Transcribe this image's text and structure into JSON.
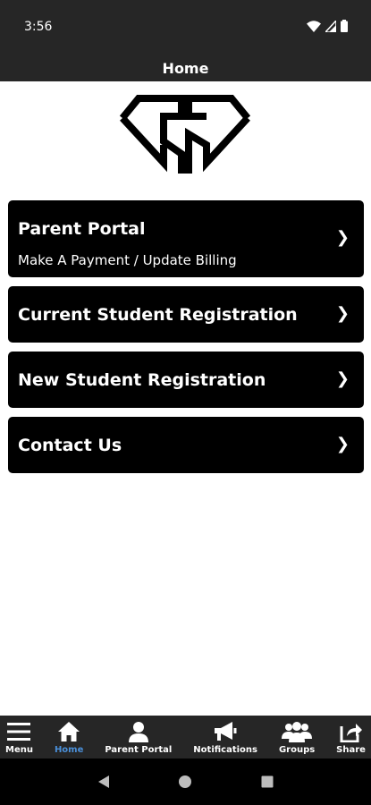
{
  "status_bar": {
    "time": "3:56",
    "icons": [
      "wifi-icon",
      "cell-signal-icon",
      "battery-icon"
    ]
  },
  "header": {
    "title": "Home"
  },
  "logo": {
    "icon": "school-logo-icon"
  },
  "menu": [
    {
      "title": "Parent Portal",
      "subtitle": "Make A Payment / Update Billing",
      "chevron": "❯"
    },
    {
      "title": "Current Student Registration",
      "chevron": "❯"
    },
    {
      "title": "New Student Registration",
      "chevron": "❯"
    },
    {
      "title": "Contact Us",
      "chevron": "❯"
    }
  ],
  "tabs": [
    {
      "label": "Menu",
      "icon": "hamburger-icon"
    },
    {
      "label": "Home",
      "icon": "home-icon",
      "active": true
    },
    {
      "label": "Parent Portal",
      "icon": "person-icon"
    },
    {
      "label": "Notifications",
      "icon": "megaphone-icon"
    },
    {
      "label": "Groups",
      "icon": "group-icon"
    },
    {
      "label": "Share",
      "icon": "share-icon"
    }
  ],
  "colors": {
    "bar_background": "#262626",
    "card_background": "#000000",
    "active_tab": "#4a8fd8"
  },
  "system_nav": [
    "back-icon",
    "home-circle-icon",
    "recents-icon"
  ]
}
